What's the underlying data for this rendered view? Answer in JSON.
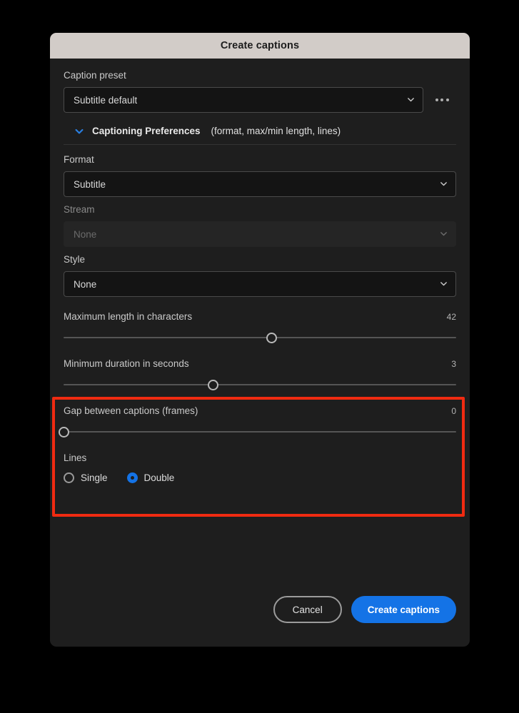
{
  "dialog": {
    "title": "Create captions"
  },
  "preset": {
    "label": "Caption preset",
    "value": "Subtitle default",
    "more_icon": "more-options-icon"
  },
  "section": {
    "title": "Captioning Preferences",
    "subtitle": "(format, max/min length, lines)",
    "expanded": true
  },
  "fields": {
    "format": {
      "label": "Format",
      "value": "Subtitle",
      "disabled": false
    },
    "stream": {
      "label": "Stream",
      "value": "None",
      "disabled": true
    },
    "style": {
      "label": "Style",
      "value": "None",
      "disabled": false
    }
  },
  "sliders": {
    "max_length": {
      "label": "Maximum length in characters",
      "value": "42",
      "percent": 53
    },
    "min_duration": {
      "label": "Minimum duration in seconds",
      "value": "3",
      "percent": 38
    },
    "gap": {
      "label": "Gap between captions (frames)",
      "value": "0",
      "percent": 0
    }
  },
  "lines": {
    "label": "Lines",
    "options": [
      {
        "label": "Single",
        "checked": false
      },
      {
        "label": "Double",
        "checked": true
      }
    ]
  },
  "footer": {
    "cancel_label": "Cancel",
    "create_label": "Create captions"
  },
  "colors": {
    "accent_blue": "#1473e6",
    "titlebar": "#d2ccc8",
    "panel": "#1e1e1e",
    "highlight": "#f02b11"
  }
}
